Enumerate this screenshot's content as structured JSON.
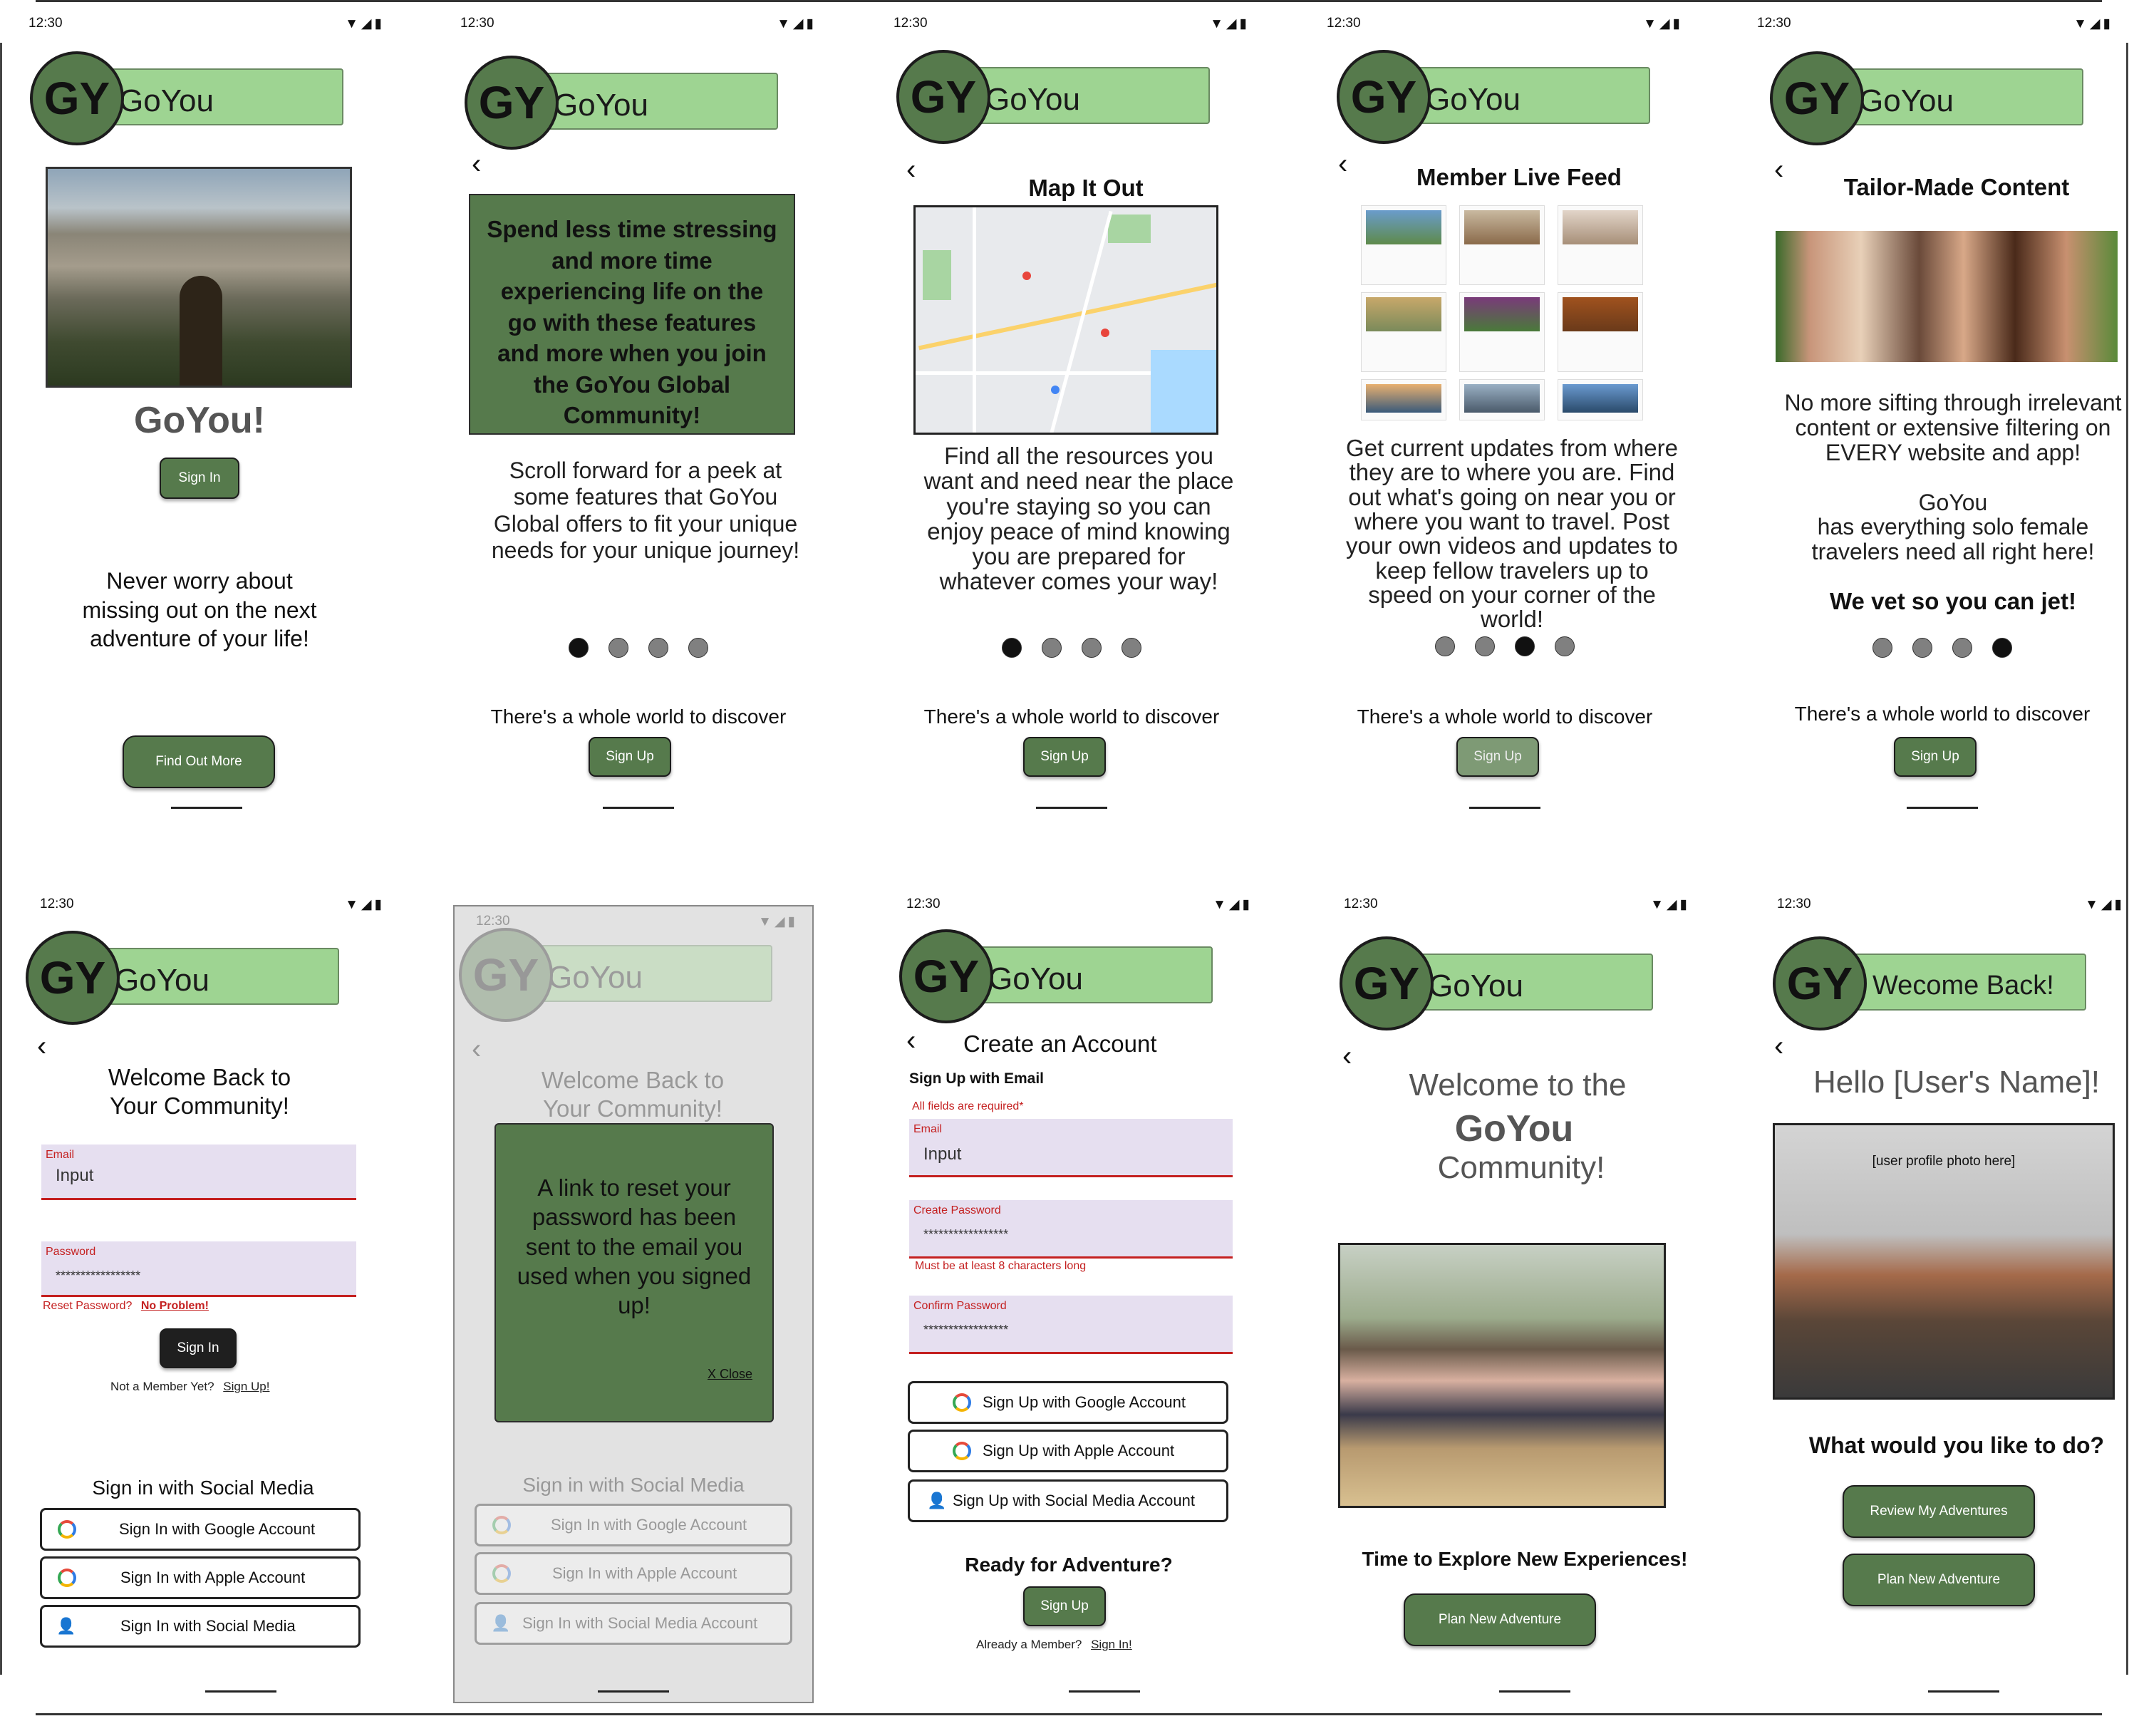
{
  "status": {
    "time": "12:30",
    "icons": "▼◢▮"
  },
  "brand": {
    "initials": "GY",
    "name": "GoYou",
    "welcome_back": "Wecome Back!"
  },
  "s1": {
    "heading": "GoYou!",
    "sign_in": "Sign In",
    "tagline": "Never worry about missing out on the next  adventure of your life!",
    "find_out": "Find Out More"
  },
  "s2": {
    "box": "Spend less time stressing and more time experiencing life on the go with these features and more when you join the GoYou Global Community!",
    "body": "Scroll forward for a peek at some features that GoYou Global offers to fit your unique needs for your unique journey!",
    "discover": "There's a whole world to discover",
    "sign_up": "Sign Up"
  },
  "s3": {
    "title": "Map It Out",
    "body": "Find all the resources you want and need near the place you're staying so you can enjoy peace of mind knowing you are prepared for whatever comes your way!",
    "discover": "There's a whole world to discover",
    "sign_up": "Sign Up"
  },
  "s4": {
    "title": "Member Live Feed",
    "body": "Get current updates from where they are to where you are. Find out what's going on near you or where you want to travel. Post your own videos and updates to keep fellow travelers up to speed on your corner of the world!",
    "discover": "There's a whole world to discover",
    "sign_up": "Sign Up"
  },
  "s5": {
    "title": "Tailor-Made Content",
    "body1": "No more sifting through irrelevant content or extensive filtering on EVERY website and app!",
    "brand": "GoYou",
    "body2": "has everything solo female travelers need all right here!",
    "vet": "We vet so you can jet!",
    "discover": "There's a whole world to discover",
    "sign_up": "Sign Up"
  },
  "s6": {
    "title": "Welcome Back to Your Community!",
    "email_label": "Email",
    "email_value": "Input",
    "password_label": "Password",
    "password_value": "*****************",
    "reset_text": "Reset Password?",
    "reset_link": "No Problem!",
    "sign_in": "Sign In",
    "not_member": "Not a Member Yet?",
    "sign_up_link": "Sign Up!",
    "social_heading": "Sign in with Social Media",
    "google": "Sign In with Google Account",
    "apple": "Sign In with Apple Account",
    "social": "Sign In  with Social Media"
  },
  "s7": {
    "title": "Welcome Back to Your Community!",
    "modal_text": "A link to reset your password has been sent to the email you used when you signed up!",
    "close": "X Close",
    "social_heading": "Sign in with Social Media",
    "google": "Sign In with Google Account",
    "apple": "Sign In with Apple Account",
    "social": "Sign In with Social Media Account"
  },
  "s8": {
    "title": "Create an Account",
    "subtitle": "Sign Up with Email",
    "required": "All fields are required*",
    "email_label": "Email",
    "email_value": "Input",
    "create_label": "Create Password",
    "create_value": "*****************",
    "create_hint": "Must be at least 8 characters long",
    "confirm_label": "Confirm Password",
    "confirm_value": "*****************",
    "google": "Sign Up with Google Account",
    "apple": "Sign Up with Apple Account",
    "social": "Sign Up with Social Media Account",
    "ready": "Ready for Adventure?",
    "sign_up": "Sign Up",
    "already": "Already a Member?",
    "sign_in_link": "Sign In!"
  },
  "s9": {
    "line1": "Welcome to the",
    "line2": "GoYou",
    "line3": "Community!",
    "explore": "Time to Explore New Experiences!",
    "plan": "Plan New Adventure"
  },
  "s10": {
    "hello": "Hello [User's Name]!",
    "photo_label": "[user profile photo here]",
    "question": "What would you like to do?",
    "review": "Review My Adventures",
    "plan": "Plan New Adventure"
  }
}
